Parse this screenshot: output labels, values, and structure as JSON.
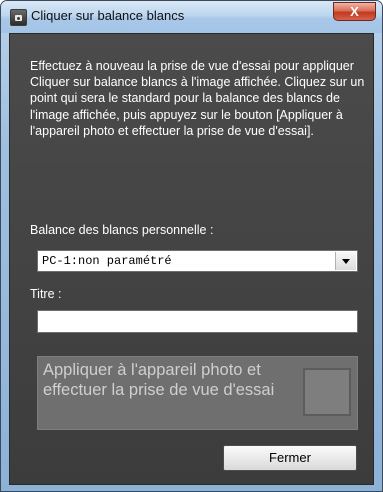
{
  "window": {
    "title": "Cliquer sur balance blancs",
    "close_glyph": "X",
    "app_icon": "camera-icon"
  },
  "main": {
    "description": "Effectuez à nouveau la prise de vue d'essai pour appliquer Cliquer sur balance blancs à l'image affichée. Cliquez sur un point qui sera le standard pour la balance des blancs de l'image affichée, puis appuyez sur le bouton [Appliquer à l'appareil photo et effectuer la prise de vue d'essai].",
    "wb_label": "Balance des blancs personnelle :",
    "wb_select_value": "PC-1:non paramétré",
    "title_label": "Titre :",
    "title_value": "",
    "apply_button_label": "Appliquer à l'appareil photo et effectuer la prise de vue d'essai",
    "close_button_label": "Fermer"
  },
  "colors": {
    "client_background": "#444444",
    "text": "#ffffff",
    "disabled_button": "#6f6f6f"
  }
}
